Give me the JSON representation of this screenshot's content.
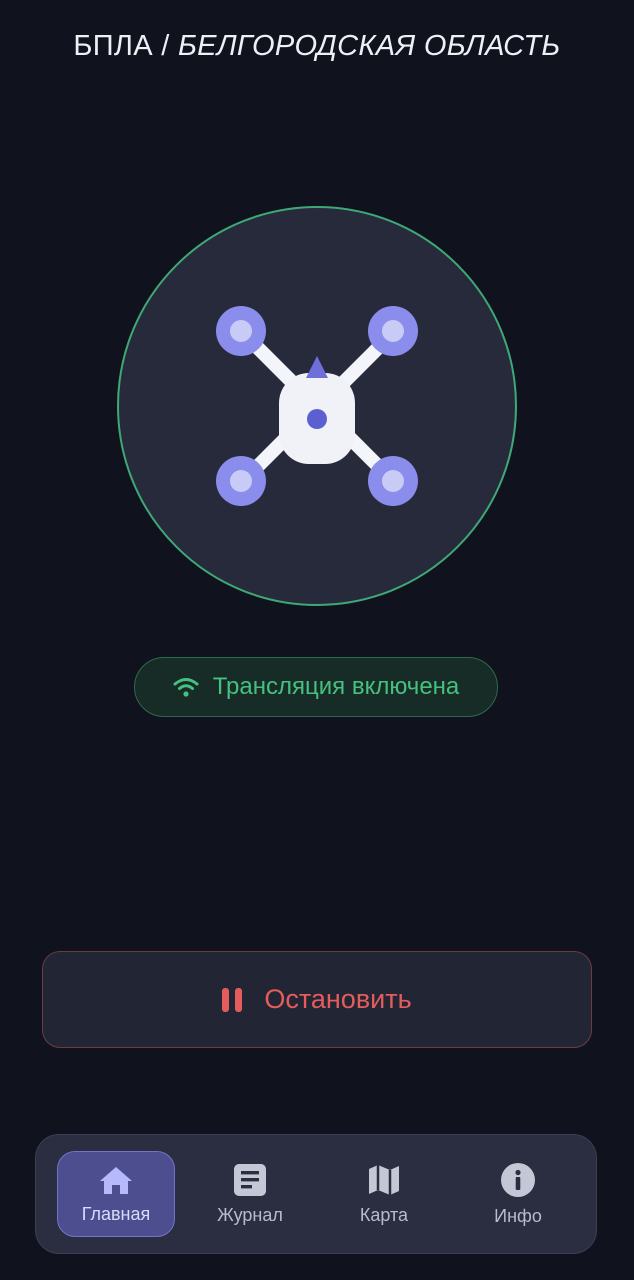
{
  "header": {
    "title_prefix": "БПЛА /",
    "title_region": "БЕЛГОРОДСКАЯ ОБЛАСТЬ"
  },
  "drone": {
    "icon": "drone-icon",
    "ring_color": "#3fa877"
  },
  "status": {
    "label": "Трансляция включена",
    "icon": "wifi-icon",
    "color": "#46c07f"
  },
  "stop_button": {
    "label": "Остановить",
    "icon": "pause-icon",
    "color": "#e55c5c"
  },
  "nav": {
    "items": [
      {
        "label": "Главная",
        "icon": "home-icon",
        "active": true
      },
      {
        "label": "Журнал",
        "icon": "journal-icon",
        "active": false
      },
      {
        "label": "Карта",
        "icon": "map-icon",
        "active": false
      },
      {
        "label": "Инфо",
        "icon": "info-icon",
        "active": false
      }
    ]
  },
  "colors": {
    "background": "#10121d",
    "accent": "#7b7fe0"
  }
}
